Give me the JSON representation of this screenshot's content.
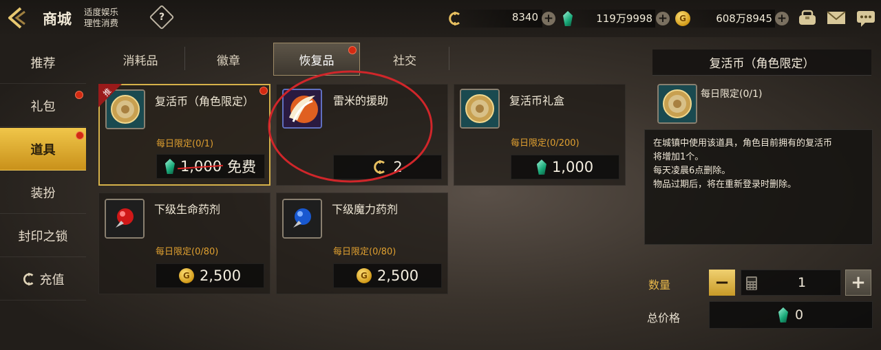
{
  "header": {
    "title": "商城",
    "slogan_line1": "适度娱乐",
    "slogan_line2": "理性消费",
    "help": "?"
  },
  "currency": [
    {
      "icon": "c-coin-icon",
      "value": "8340"
    },
    {
      "icon": "green-gem-icon",
      "value": "119万9998"
    },
    {
      "icon": "gold-coin-icon",
      "value": "608万8945"
    }
  ],
  "sidebar": {
    "items": [
      {
        "label": "推荐"
      },
      {
        "label": "礼包",
        "badge": true
      },
      {
        "label": "道具",
        "badge": true,
        "active": true
      },
      {
        "label": "装扮"
      },
      {
        "label": "封印之锁"
      },
      {
        "label": "充值"
      }
    ]
  },
  "tabs": [
    {
      "label": "消耗品"
    },
    {
      "label": "徽章"
    },
    {
      "label": "恢复品",
      "active": true,
      "badge": true
    },
    {
      "label": "社交"
    }
  ],
  "items": [
    {
      "name": "复活币（角色限定）",
      "limit": "每日限定(0/1)",
      "price_old": "1,000",
      "price_new": "免费",
      "currency": "green-gem-icon",
      "tag": "推"
    },
    {
      "name": "雷米的援助",
      "limit": "",
      "price": "2",
      "currency": "c-coin-icon"
    },
    {
      "name": "复活币礼盒",
      "limit": "每日限定(0/200)",
      "price": "1,000",
      "currency": "green-gem-icon"
    },
    {
      "name": "下级生命药剂",
      "limit": "每日限定(0/80)",
      "price": "2,500",
      "currency": "gold-coin-icon"
    },
    {
      "name": "下级魔力药剂",
      "limit": "每日限定(0/80)",
      "price": "2,500",
      "currency": "gold-coin-icon"
    }
  ],
  "detail": {
    "title": "复活币（角色限定）",
    "limit": "每日限定(0/1)",
    "desc": [
      "在城镇中使用该道具，角色目前拥有的复活币",
      "将增加1个。",
      "每天凌晨6点删除。",
      "物品过期后，将在重新登录时删除。"
    ],
    "qty_label": "数量",
    "qty": "1",
    "minus": "−",
    "plus": "+",
    "total_label": "总价格",
    "total": "0"
  },
  "colors": {
    "accent_gold": "#f0c64a",
    "limit_orange": "#e0a030",
    "badge_red": "#d22a12",
    "annotation_red": "#d0262a"
  }
}
